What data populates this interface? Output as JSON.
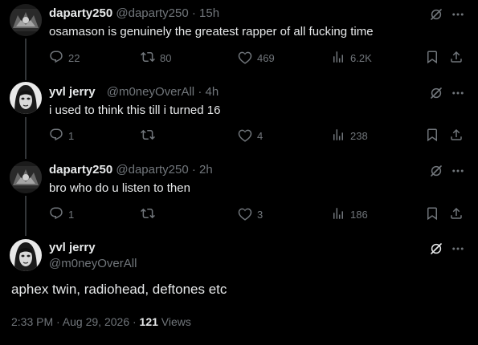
{
  "tweets": [
    {
      "name": "daparty250",
      "handle": "@daparty250",
      "time": "· 15h",
      "text": "osamason is genuinely the greatest rapper of all fucking time",
      "replies": "22",
      "retweets": "80",
      "likes": "469",
      "views": "6.2K"
    },
    {
      "name": "yvl jerry",
      "handle": "@m0neyOverAll",
      "time": "· 4h",
      "text": "i used to think this till i turned 16",
      "replies": "1",
      "retweets": "",
      "likes": "4",
      "views": "238"
    },
    {
      "name": "daparty250",
      "handle": "@daparty250",
      "time": "· 2h",
      "text": "bro who do u listen to then",
      "replies": "1",
      "retweets": "",
      "likes": "3",
      "views": "186"
    }
  ],
  "main": {
    "name": "yvl jerry",
    "handle": "@m0neyOverAll",
    "text": "aphex twin, radiohead, deftones etc",
    "timestamp": "2:33 PM · Aug 29, 2026 · ",
    "views_count": "121",
    "views_label": " Views"
  },
  "icons": {
    "reply": "reply-icon",
    "retweet": "retweet-icon",
    "like": "like-icon",
    "views": "views-icon",
    "bookmark": "bookmark-icon",
    "share": "share-icon",
    "grok": "grok-icon",
    "more": "more-icon"
  },
  "colors": {
    "background": "#000000",
    "text": "#e7e9ea",
    "muted": "#71767b",
    "line": "#333639"
  }
}
